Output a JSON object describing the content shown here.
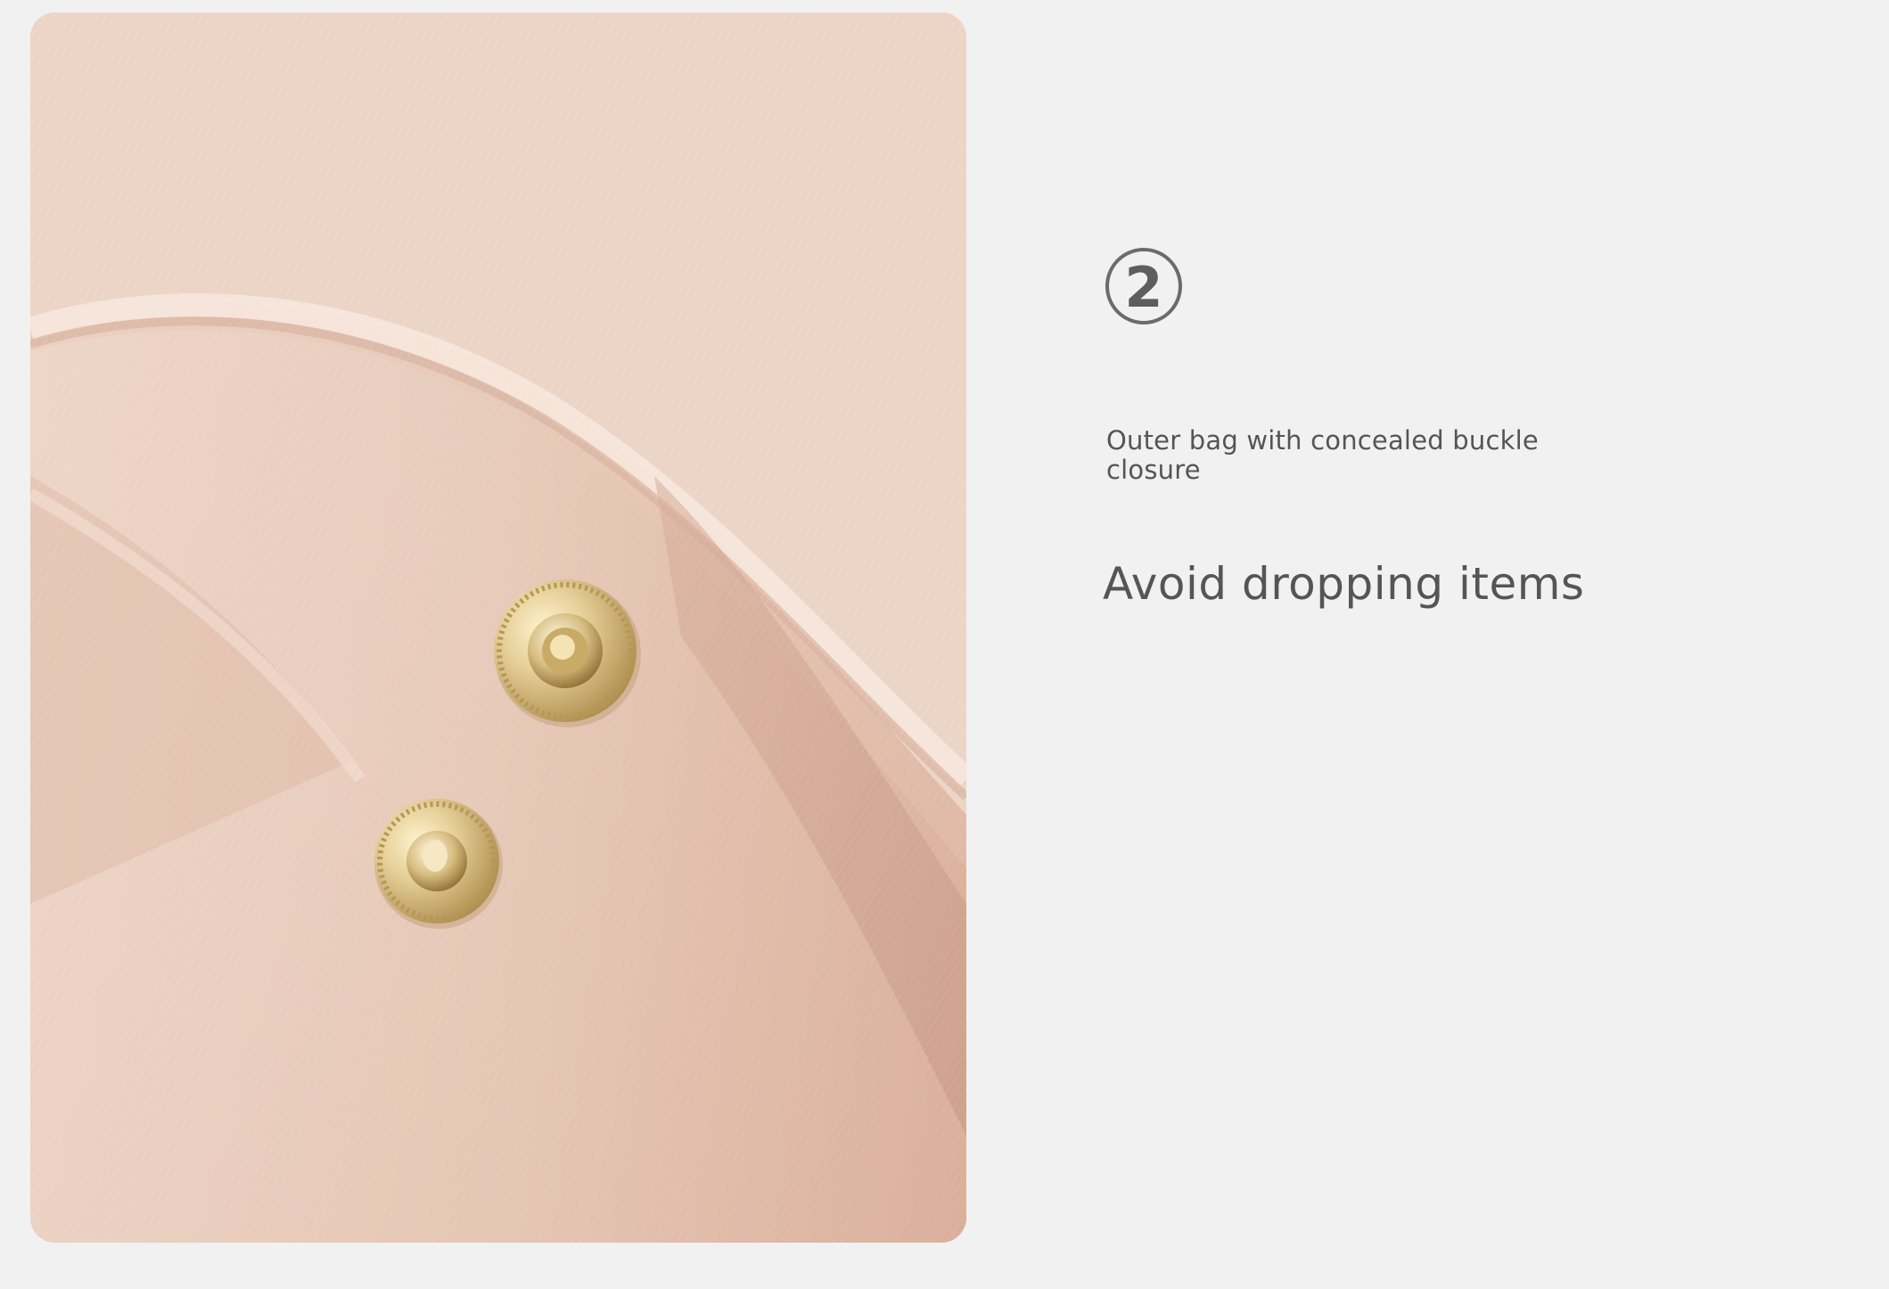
{
  "feature": {
    "number": "2",
    "subtitle": "Outer bag with concealed buckle closure",
    "headline": "Avoid dropping items"
  },
  "photo": {
    "subject": "champagne satin fabric with two gold snap buttons",
    "colors": {
      "fabric_light": "#ead1c1",
      "fabric_mid": "#ddb9a5",
      "fabric_shadow": "#c99f8a",
      "gold": "#d7bf83",
      "gold_dark": "#9c7f40"
    }
  },
  "colors": {
    "background": "#f2f1f1",
    "text": "#555555",
    "badge_border": "#6b6b6b"
  }
}
